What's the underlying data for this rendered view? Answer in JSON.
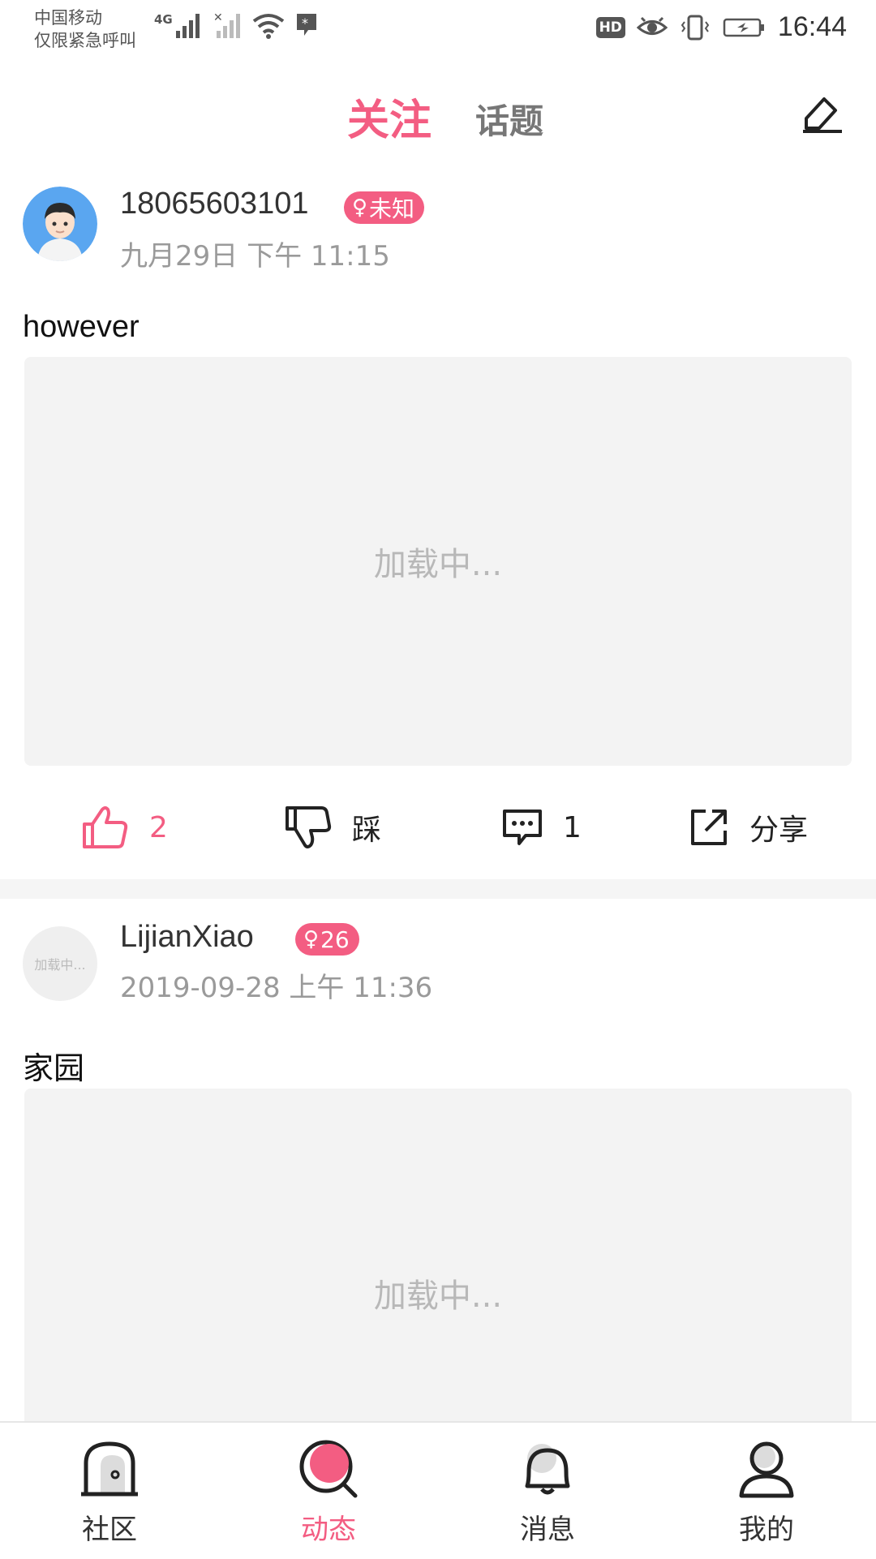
{
  "status_bar": {
    "carrier_line1": "中国移动",
    "carrier_line2": "仅限紧急呼叫",
    "network": "4G",
    "hd": "HD",
    "time": "16:44"
  },
  "top_nav": {
    "tab_follow": "关注",
    "tab_topic": "话题"
  },
  "posts": [
    {
      "username": "18065603101",
      "badge": "未知",
      "time": "九月29日 下午 11:15",
      "text": "however",
      "image_loading": "加载中...",
      "likes": "2",
      "dislike_label": "踩",
      "comments": "1",
      "share_label": "分享"
    },
    {
      "avatar_loading": "加载中...",
      "username": "LijianXiao",
      "badge": "26",
      "time": "2019-09-28 上午 11:36",
      "text": "家园",
      "image_loading": "加载中..."
    }
  ],
  "bottom_nav": [
    {
      "label": "社区",
      "active": false
    },
    {
      "label": "动态",
      "active": true
    },
    {
      "label": "消息",
      "active": false
    },
    {
      "label": "我的",
      "active": false
    }
  ],
  "colors": {
    "accent": "#f35d82",
    "secondary_text": "#9a9a9a",
    "placeholder_bg": "#f3f3f3"
  }
}
